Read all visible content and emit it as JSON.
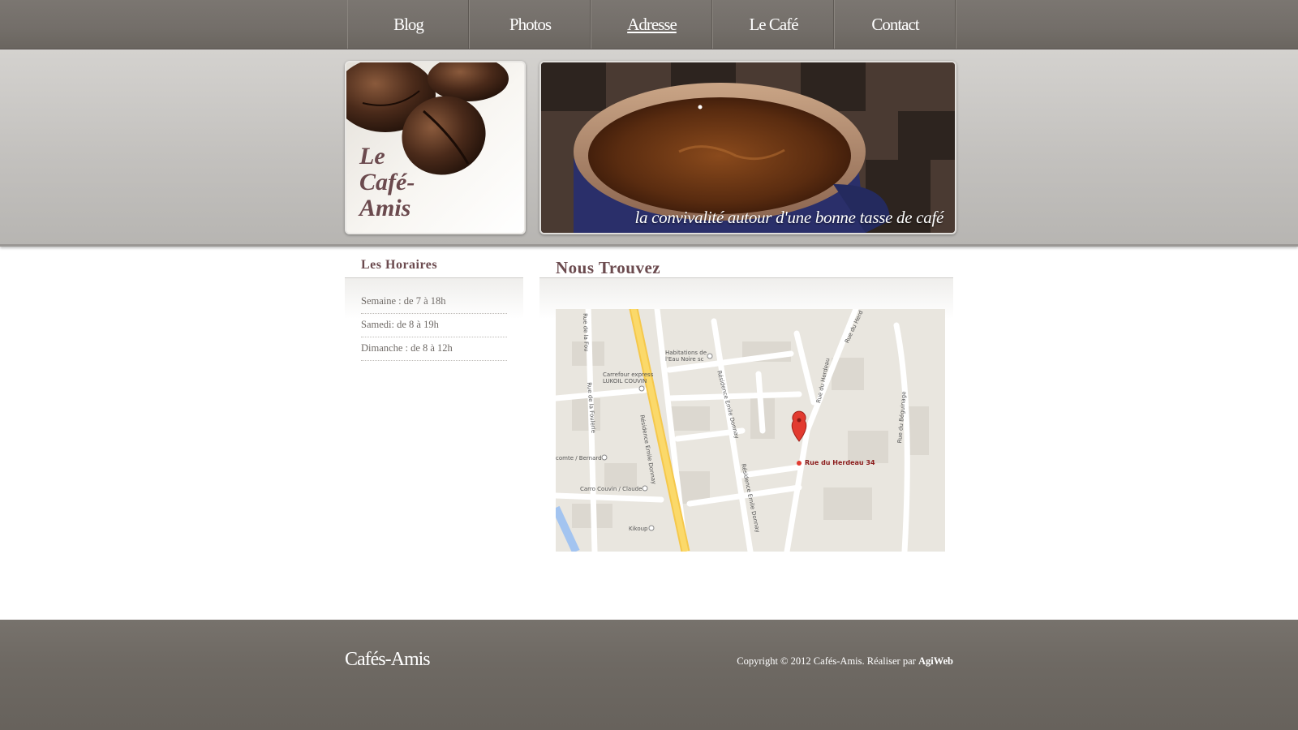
{
  "nav": {
    "items": [
      {
        "label": "Blog"
      },
      {
        "label": "Photos"
      },
      {
        "label": "Adresse",
        "active": true
      },
      {
        "label": "Le Café"
      },
      {
        "label": "Contact"
      }
    ]
  },
  "header": {
    "logo_line1": "Le",
    "logo_line2": "Café-",
    "logo_line3": "Amis",
    "tagline": "la convivalité autour d'une bonne tasse de café"
  },
  "sidebar": {
    "title": "Les Horaires",
    "hours": [
      "Semaine : de 7 à 18h",
      "Samedi: de 8 à 19h",
      "Dimanche : de 8 à 12h"
    ]
  },
  "main": {
    "title": "Nous Trouvez",
    "map": {
      "marker_label": "Rue du Herdeau 34",
      "labels": {
        "habitations1": "Habitations de",
        "habitations2": "l'Eau Noire sc",
        "carrefour1": "Carrefour express",
        "carrefour2": "LUKOIL COUVIN",
        "residence1": "Résidence Emile Donnay",
        "residence2": "Résidence Emile Donnay",
        "residence3": "Résidence Emile Donnay",
        "herdeau": "Rue du Herdeau",
        "rueHerd": "Rue du Herd",
        "foulerie1": "Rue de la Foulerie",
        "foulerie2": "Rue de la Fou",
        "beguinage": "Rue du Béguinage",
        "comte": "comte / Bernard",
        "carro": "Carro Couvin / Claude",
        "kikoup": "Kikoup"
      }
    }
  },
  "footer": {
    "logo": "Cafés-Amis",
    "copyright": "Copyright © 2012 Cafés-Amis. Réaliser par",
    "credit": "AgiWeb"
  },
  "colors": {
    "accent": "#6b4a4e",
    "nav_bg": "#736e69",
    "footer_bg": "#6e6963"
  }
}
